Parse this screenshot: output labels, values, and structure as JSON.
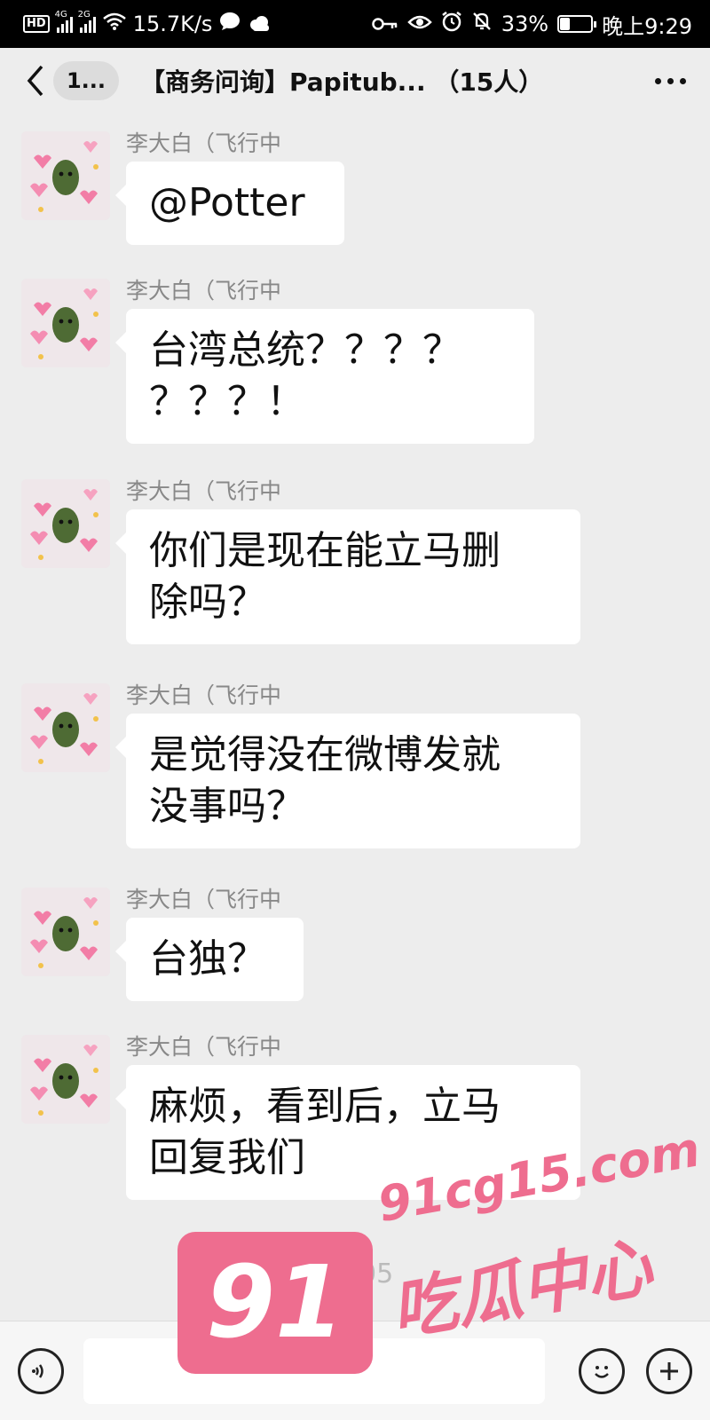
{
  "status_bar": {
    "hd_badge": "HD",
    "sim1": "4G",
    "sim2": "2G",
    "net_speed": "15.7K/s",
    "battery": "33%",
    "battery_level": 0.33,
    "time": "晚上9:29",
    "icons": [
      "wifi-icon",
      "chat-icon",
      "cloud-icon",
      "key-icon",
      "eye-icon",
      "alarm-icon",
      "mute-icon",
      "battery-icon"
    ]
  },
  "title_bar": {
    "unread_count": "1...",
    "title": "【商务问询】Papitub... （15人）"
  },
  "messages": [
    {
      "sender": "李大白（飞行中",
      "text_lines": [
        "@Potter"
      ]
    },
    {
      "sender": "李大白（飞行中",
      "text_lines": [
        "台湾总统？？？？",
        "？？？！"
      ]
    },
    {
      "sender": "李大白（飞行中",
      "text_lines": [
        "你们是现在能立马删",
        "除吗？"
      ]
    },
    {
      "sender": "李大白（飞行中",
      "text_lines": [
        "是觉得没在微博发就",
        "没事吗？"
      ]
    },
    {
      "sender": "李大白（飞行中",
      "text_lines": [
        "台独？"
      ]
    },
    {
      "sender": "李大白（飞行中",
      "text_lines": [
        "麻烦，看到后，立马",
        "回复我们"
      ]
    }
  ],
  "timestamp": "18:05",
  "input_bar": {
    "voice_icon": "voice-icon",
    "emoji_icon": "emoji-icon",
    "plus_icon": "plus-icon",
    "text": ""
  },
  "watermark": {
    "number": "91",
    "url": "91cg15.com",
    "name": "吃瓜中心",
    "color": "#ee6d8f"
  }
}
